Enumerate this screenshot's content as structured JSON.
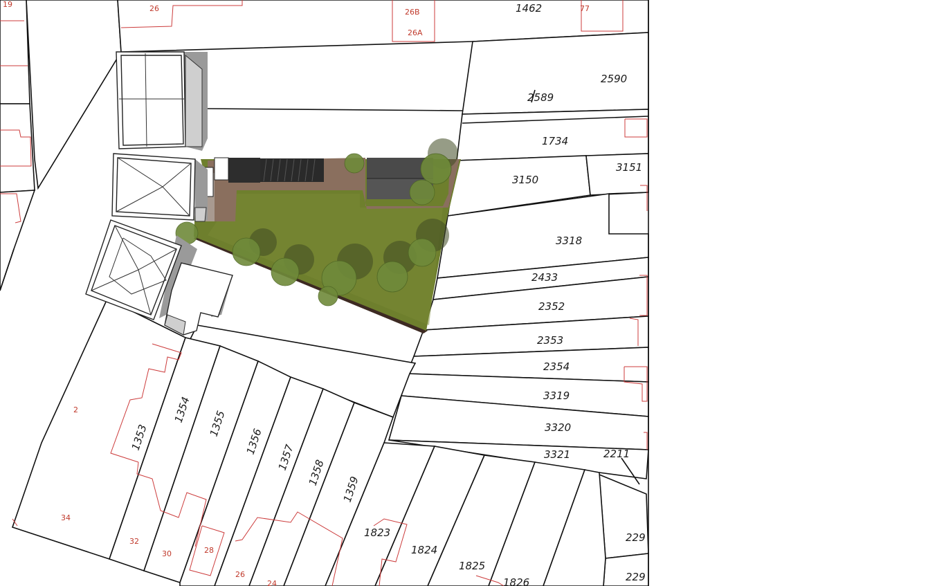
{
  "map": {
    "colors": {
      "lawn": "#6e7f2d",
      "paving": "#8a6f5e",
      "shed": "#333333",
      "parcel_line": "#111111",
      "building_outline": "#cc3b3b"
    },
    "parcel_labels": [
      "1462",
      "2590",
      "2589",
      "1734",
      "3150",
      "3151",
      "3318",
      "2433",
      "2352",
      "2353",
      "2354",
      "3319",
      "3320",
      "3321",
      "2211",
      "229",
      "229",
      "1353",
      "1354",
      "1355",
      "1356",
      "1357",
      "1358",
      "1359",
      "1823",
      "1824",
      "1825",
      "1826"
    ],
    "house_numbers": [
      "19",
      "26",
      "26B",
      "26A",
      "77",
      "2",
      "34",
      "32",
      "30",
      "28",
      "26",
      "24"
    ]
  }
}
